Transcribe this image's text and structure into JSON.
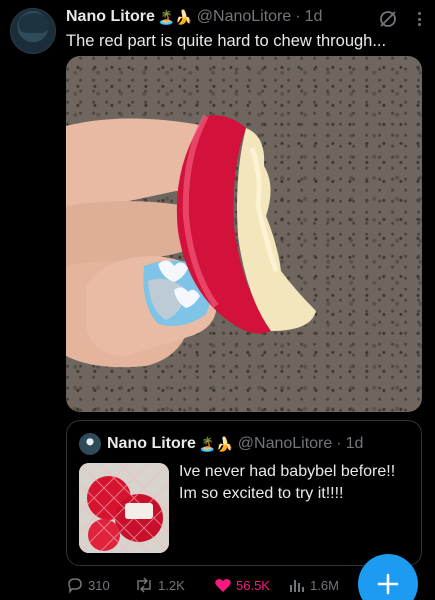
{
  "tweet": {
    "author_name": "Nano Litore",
    "author_emojis": "🏝️🍌",
    "handle": "@NanoLitore",
    "time": "1d",
    "text": "The red part is quite hard to chew through...",
    "icons": {
      "grok": "grok-icon",
      "more": "more-icon"
    }
  },
  "quoted_tweet": {
    "author_name": "Nano Litore",
    "author_emojis": "🏝️🍌",
    "handle": "@NanoLitore",
    "time": "1d",
    "text": "Ive never had babybel before!! Im so excited to try it!!!!"
  },
  "actions": {
    "replies": "310",
    "reposts": "1.2K",
    "likes": "56.5K",
    "views": "1.6M",
    "liked": true
  },
  "colors": {
    "accent": "#1d9bf0",
    "like": "#f91880",
    "muted": "#71767b",
    "text": "#e7e9ea"
  }
}
